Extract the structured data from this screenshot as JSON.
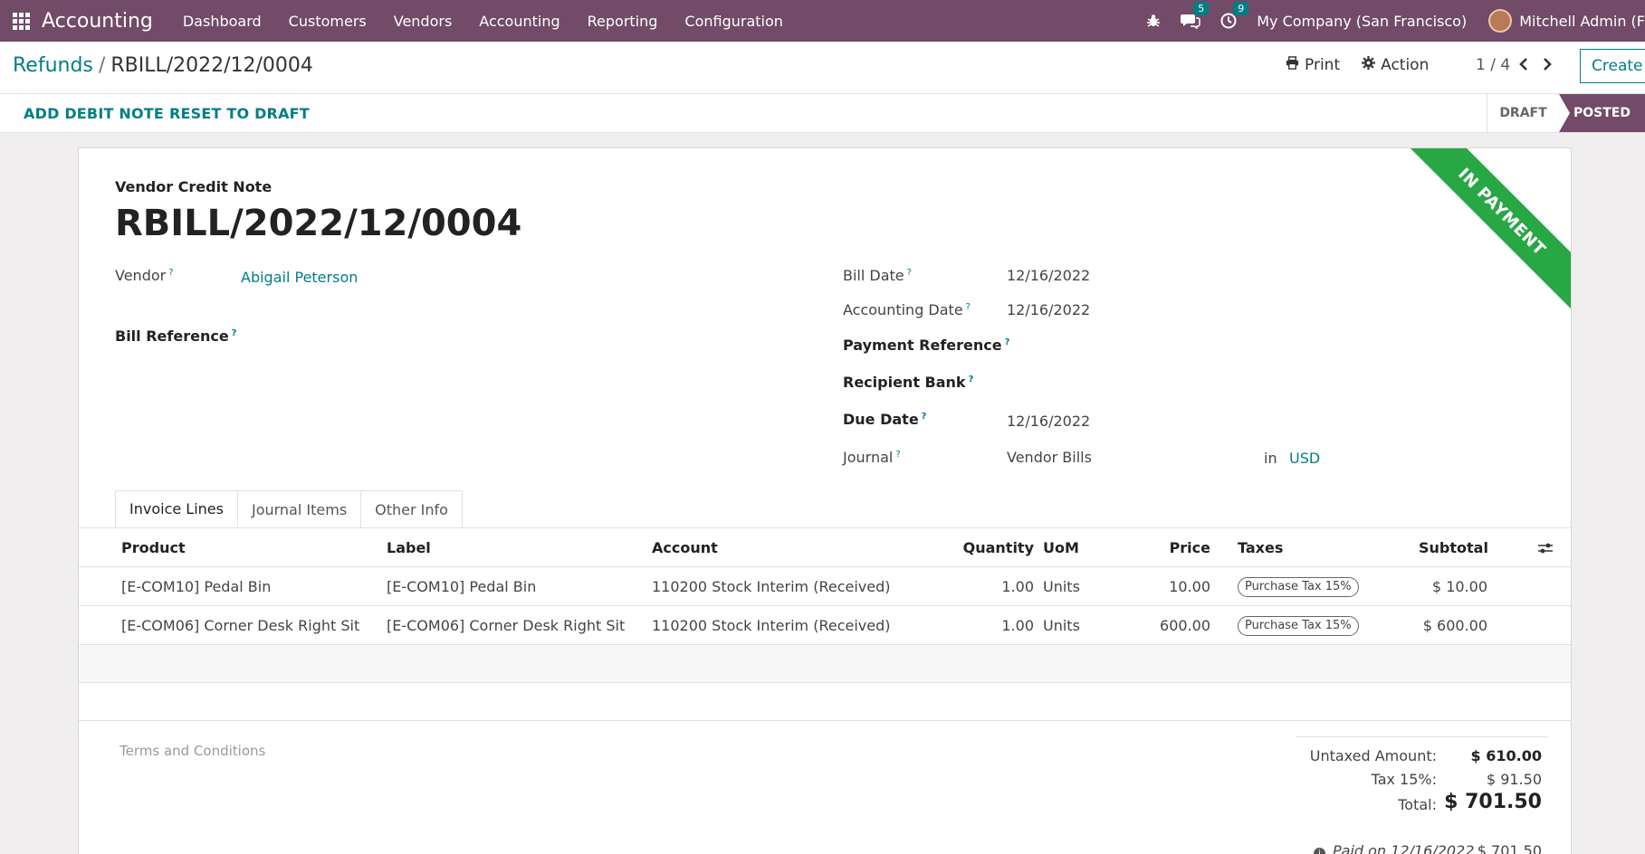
{
  "navbar": {
    "brand": "Accounting",
    "menu": [
      "Dashboard",
      "Customers",
      "Vendors",
      "Accounting",
      "Reporting",
      "Configuration"
    ],
    "chat_count": "5",
    "activity_count": "9",
    "company": "My Company (San Francisco)",
    "user": "Mitchell Admin (F"
  },
  "control_panel": {
    "breadcrumb_parent": "Refunds",
    "breadcrumb_current": "RBILL/2022/12/0004",
    "print_label": "Print",
    "action_label": "Action",
    "pager": "1 / 4",
    "create_label": "Create"
  },
  "status_bar": {
    "add_debit_note": "ADD DEBIT NOTE",
    "reset_to_draft": "RESET TO DRAFT",
    "states": [
      "DRAFT",
      "POSTED"
    ],
    "active_state": "POSTED"
  },
  "form": {
    "ribbon": "IN PAYMENT",
    "doc_type": "Vendor Credit Note",
    "name": "RBILL/2022/12/0004",
    "vendor_label": "Vendor",
    "vendor": "Abigail Peterson",
    "bill_reference_label": "Bill Reference",
    "bill_date_label": "Bill Date",
    "bill_date": "12/16/2022",
    "accounting_date_label": "Accounting Date",
    "accounting_date": "12/16/2022",
    "payment_reference_label": "Payment Reference",
    "recipient_bank_label": "Recipient Bank",
    "due_date_label": "Due Date",
    "due_date": "12/16/2022",
    "journal_label": "Journal",
    "journal": "Vendor Bills",
    "in_label": "in",
    "currency": "USD",
    "help_mark": "?"
  },
  "tabs": [
    "Invoice Lines",
    "Journal Items",
    "Other Info"
  ],
  "lines": {
    "headers": {
      "product": "Product",
      "label": "Label",
      "account": "Account",
      "quantity": "Quantity",
      "uom": "UoM",
      "price": "Price",
      "taxes": "Taxes",
      "subtotal": "Subtotal"
    },
    "rows": [
      {
        "product": "[E-COM10] Pedal Bin",
        "label": "[E-COM10] Pedal Bin",
        "account": "110200 Stock Interim (Received)",
        "quantity": "1.00",
        "uom": "Units",
        "price": "10.00",
        "tax": "Purchase Tax 15%",
        "subtotal": "$ 10.00"
      },
      {
        "product": "[E-COM06] Corner Desk Right Sit",
        "label": "[E-COM06] Corner Desk Right Sit",
        "account": "110200 Stock Interim (Received)",
        "quantity": "1.00",
        "uom": "Units",
        "price": "600.00",
        "tax": "Purchase Tax 15%",
        "subtotal": "$ 600.00"
      }
    ]
  },
  "terms_placeholder": "Terms and Conditions",
  "totals": {
    "untaxed_label": "Untaxed Amount:",
    "untaxed": "$ 610.00",
    "tax_label": "Tax 15%:",
    "tax": "$ 91.50",
    "total_label": "Total:",
    "total": "$ 701.50",
    "paid_label": "Paid on 12/16/2022",
    "paid": "$ 701.50"
  },
  "colors": {
    "brand": "#714b67",
    "link": "#017e84",
    "ribbon": "#28a745"
  }
}
